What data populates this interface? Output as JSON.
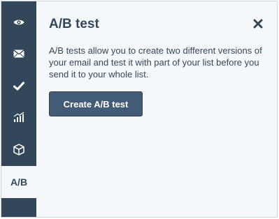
{
  "sidebar": {
    "items": [
      {
        "icon": "eye-icon"
      },
      {
        "icon": "envelope-icon"
      },
      {
        "icon": "checkmark-icon"
      },
      {
        "icon": "bar-chart-icon"
      },
      {
        "icon": "cube-icon"
      },
      {
        "label": "A/B",
        "active": true
      }
    ]
  },
  "panel": {
    "title": "A/B test",
    "description": "A/B tests allow you to create two different versions of your email and test it with part of your list before you send it to your whole list.",
    "button_label": "Create A/B test",
    "close_icon": "close-icon"
  },
  "colors": {
    "rail": "#33475b",
    "panel_bg": "#f5f8fa",
    "text": "#33475b",
    "button": "#425b76"
  }
}
